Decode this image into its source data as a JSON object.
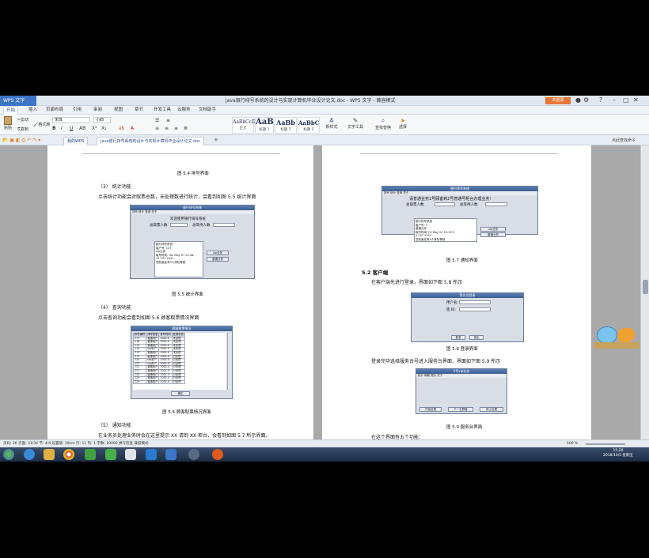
{
  "window": {
    "app_button": "WPS 文字",
    "title": "java银行排号系统的设计与实现计算机毕业设计论文.doc - WPS 文字 - 兼容模式",
    "login_button": "未登录"
  },
  "menu": [
    "开始",
    "插入",
    "页面布局",
    "引用",
    "审阅",
    "视图",
    "章节",
    "开发工具",
    "云服务",
    "文档助手"
  ],
  "ribbon": {
    "paste_label": "粘贴",
    "cut_label": "剪切",
    "copy_label": "复制",
    "format_painter_label": "格式刷",
    "font_name": "宋体",
    "font_size": "小四",
    "styles": [
      {
        "sample": "AaBbCcDd",
        "label": "正文"
      },
      {
        "sample": "AaB",
        "label": "标题 1"
      },
      {
        "sample": "AaBb",
        "label": "标题 2"
      },
      {
        "sample": "AaBbC",
        "label": "标题 3"
      }
    ],
    "new_style_label": "新样式",
    "text_tools_label": "文字工具",
    "find_replace_label": "查找替换",
    "select_label": "选择"
  },
  "tabs": {
    "home_tab": "我的WPS",
    "doc_tab": "java银行排号系统的设计与实现计算机毕业设计论文.doc",
    "search_hint": "点此查找命令"
  },
  "left_page": {
    "cap_64": "图 5.4 排号界面",
    "item3": "（3） 统计功能",
    "para_stats": "点击统计功能会对取票总数，未处理数进行统计，会看到如图 5.5 统计界面",
    "cap_65": "图 5.5 统计界面",
    "item4": "（4） 查询功能",
    "para_query": "点击查询功能会看到如图 5.6 顾客取票情况界面",
    "cap_66": "图 5.6 顾客取票情况界面",
    "item5": "（5） 通知功能",
    "para_notify": "在业务员处理业务时会在这里提示 XX 请到 XX 柜台，会看到如图 5.7 所示界面。"
  },
  "stats_window": {
    "title": "银行排号系统",
    "menu": "排号  统计  查询  关于",
    "heading": "欢迎使用银行排号系统",
    "total_label": "总取票人数",
    "wait_label": "总等待人数",
    "area_text": "银行排号系统\n客户号: 107\nvip业务\n取号时间: Tue May 07 22:38:\n17 CST 2013\n您前面还有3人排队等候",
    "btn1": "vip业务",
    "btn2": "普通业务"
  },
  "query_window": {
    "title": "顾客取票情况",
    "headers": [
      "排号编号",
      "排号类型",
      "排号时间",
      "处理状态"
    ],
    "rows": [
      [
        "117",
        "普通用户",
        "2002-0",
        "未处理"
      ],
      [
        "116",
        "普通用户",
        "2002-0",
        "未处理"
      ],
      [
        "115",
        "普通用户",
        "2002-0",
        "未处理"
      ],
      [
        "114",
        "vip用户",
        "2002-0",
        "未处理"
      ],
      [
        "113",
        "普通用户",
        "2002-0",
        "未处理"
      ],
      [
        "112",
        "普通用户",
        "2002-0",
        "已处理"
      ],
      [
        "124",
        "vip用户",
        "2002-0",
        "已处理"
      ],
      [
        "123",
        "vip用户",
        "2002-0",
        "已处理"
      ],
      [
        "122",
        "普通用户",
        "2002-0",
        "已处理"
      ],
      [
        "121",
        "普通用户",
        "2002-0",
        "已处理"
      ],
      [
        "120",
        "普通用户",
        "2002-0",
        "已处理"
      ],
      [
        "129",
        "普通用户",
        "2002-0",
        "已处理"
      ],
      [
        "128",
        "普通用户",
        "2002-0",
        "已处理"
      ]
    ],
    "ok_button": "确定"
  },
  "right_page": {
    "cap_67": "图 5.7 通知界面",
    "section_52": "5.2 客户端",
    "para_login": "在客户端先进行登录，界面如下图 5.8 所示",
    "cap_68": "图 5.8 登录界面",
    "para_service": "登录完毕选择服务台号进入服务台界面，界面如下图 5.9 所示",
    "cap_69": "图 5.9 服务台界面",
    "para_five": "在这个界面有五个功能："
  },
  "notify_window": {
    "title": "银行排号系统",
    "menu": "排号  统计  查询  关于",
    "banner": "请普通业务1号顾客到2号普通号柜台办理业务!",
    "total_label": "总取票人数",
    "wait_label": "总等待人数",
    "area_text": "银行排号系统\n客户号: 1\n普通业务\n取号时间: Fri May 10 10:19:3\n1 CST 2013\n您前面还有5人排队等候",
    "btn1": "vip业务",
    "btn2": "普通业务"
  },
  "login_window": {
    "title": "营业员登录",
    "user_label": "用户名:",
    "pass_label": "密  码:",
    "login_btn": "登录",
    "exit_btn": "退出"
  },
  "service_window": {
    "title": "1号vip业务",
    "menu": "统计  刷新  提示  关于",
    "btn1": "开始处理",
    "btn2": "下一位顾客",
    "btn3": "停止处理"
  },
  "statusbar": {
    "text": "页码: 26  页面: 31/36  节: 4/4  设置值: 18cm  行: 11  列: 1  字数: 10000  拼写检查  兼容模式",
    "zoom": "100 %"
  },
  "taskbar": {
    "time": "15:20",
    "date": "2018/10/5 星期五"
  },
  "colors": {
    "wps_blue": "#3b76c7",
    "login_orange": "#e6763a",
    "taskbar": "#1d2c44"
  }
}
